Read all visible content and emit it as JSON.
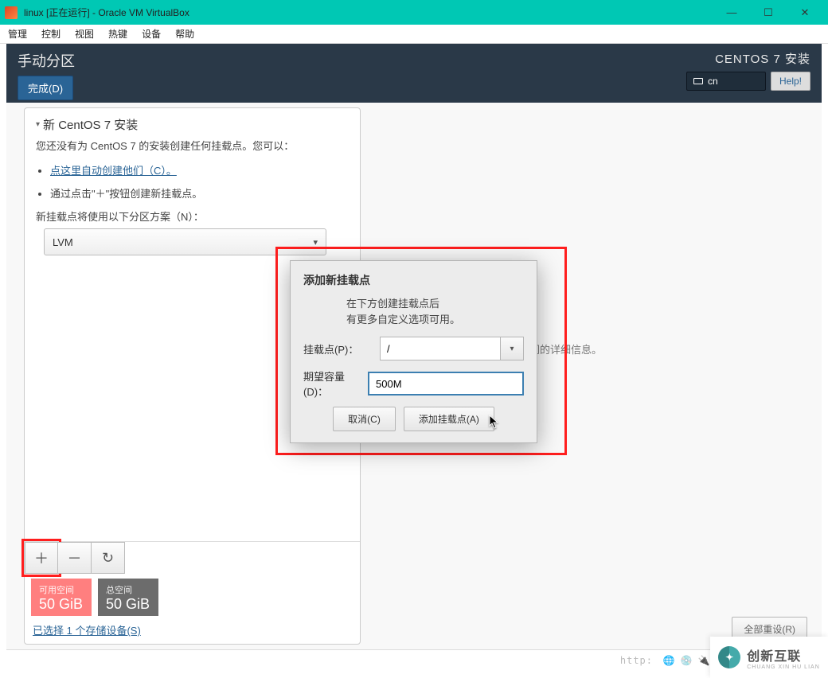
{
  "vb": {
    "title": "linux [正在运行] - Oracle VM VirtualBox",
    "menu": [
      "管理",
      "控制",
      "视图",
      "热键",
      "设备",
      "帮助"
    ],
    "status_http": "http:",
    "status_icons": [
      "net-icon",
      "disk-icon",
      "usb-icon",
      "shared-folder-icon",
      "audio-icon",
      "display-icon",
      "video-icon",
      "record-icon",
      "keyboard-icon"
    ]
  },
  "installer": {
    "header_title": "手动分区",
    "done_label": "完成(D)",
    "brand": "CENTOS 7 安装",
    "lang": "cn",
    "help_label": "Help!",
    "tree_title": "新 CentOS 7 安装",
    "tree_sub": "您还没有为 CentOS 7 的安装创建任何挂载点。您可以：",
    "bullet_link": "点这里自动创建他们（C）。",
    "bullet_plus": "通过点击\"＋\"按钮创建新挂载点。",
    "scheme_label": "新挂载点将使用以下分区方案（N）：",
    "scheme_value": "LVM",
    "right_desc": "建挂载点后，您可在这里浏览它们的详细信息。",
    "space": {
      "avail_label": "可用空间",
      "avail_value": "50 GiB",
      "total_label": "总空间",
      "total_value": "50 GiB"
    },
    "device_link": "已选择 1 个存储设备(S)",
    "reset_label": "全部重设(R)"
  },
  "modal": {
    "title": "添加新挂载点",
    "desc1": "在下方创建挂载点后",
    "desc2": "有更多自定义选项可用。",
    "mount_label": "挂载点(P)：",
    "mount_value": "/",
    "size_label": "期望容量(D)：",
    "size_value": "500M",
    "cancel": "取消(C)",
    "add": "添加挂载点(A)"
  },
  "watermark": {
    "brand": "创新互联",
    "sub": "CHUANG XIN HU LIAN"
  }
}
